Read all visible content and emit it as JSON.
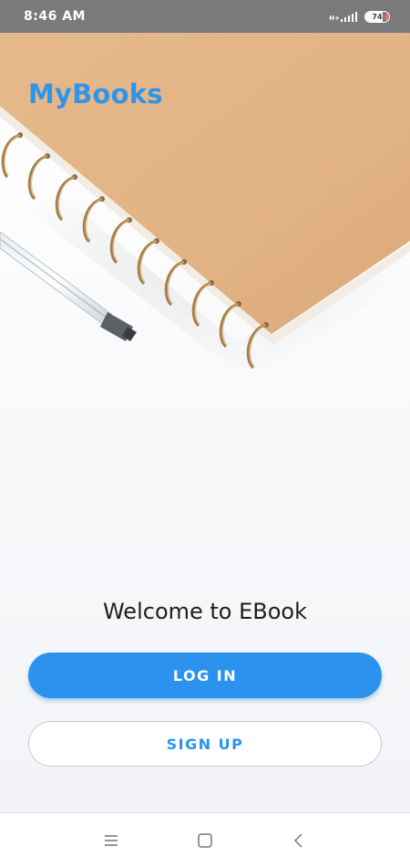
{
  "status_bar": {
    "time": "8:46 AM",
    "network": "H+",
    "battery_percent": "74",
    "battery_level": 0.74
  },
  "app": {
    "brand": "MyBooks",
    "welcome": "Welcome to EBook",
    "login_label": "LOG IN",
    "signup_label": "SIGN UP"
  },
  "nav": {
    "menu_icon": "menu-icon",
    "home_icon": "home-square-icon",
    "back_icon": "back-chevron-icon"
  },
  "colors": {
    "accent": "#2b93ee",
    "brand": "#2f94ea",
    "status_bar": "#7a7a7a"
  }
}
